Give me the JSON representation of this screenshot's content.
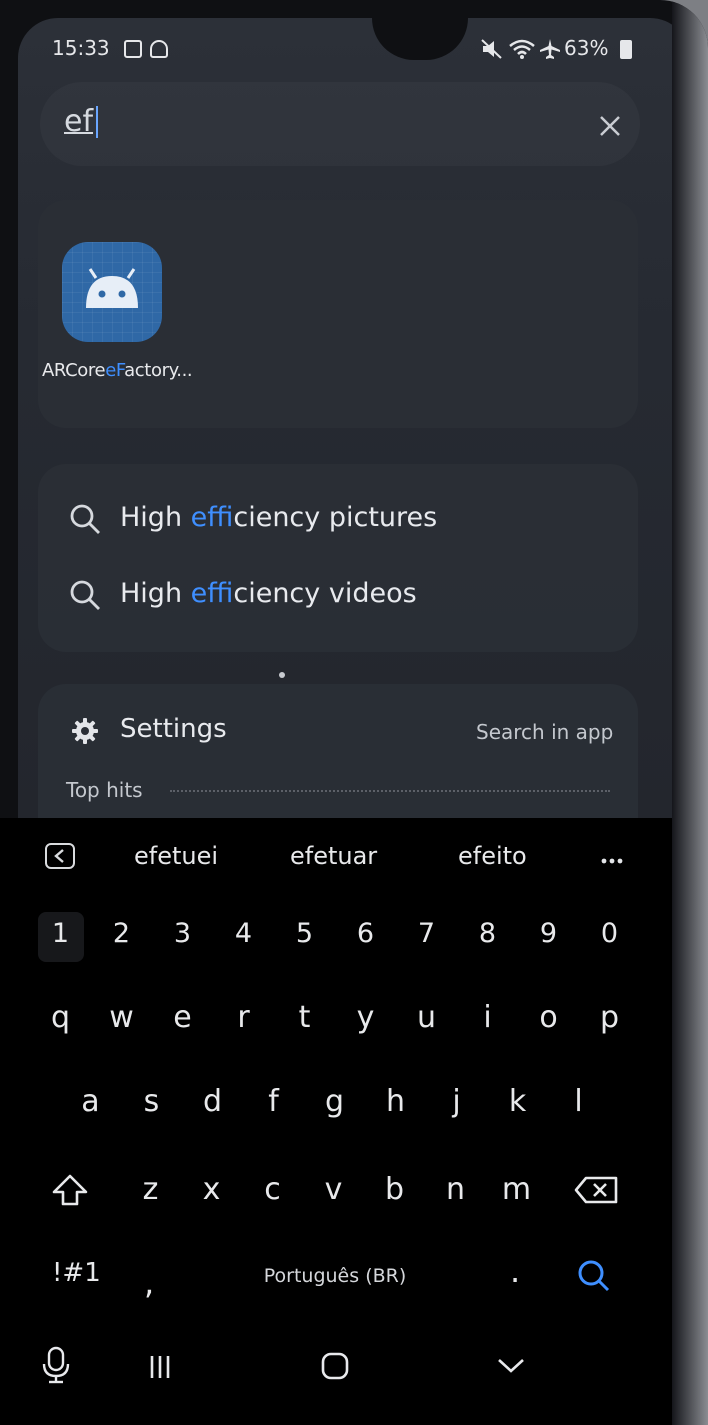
{
  "status_bar": {
    "time": "15:33",
    "battery": "63%"
  },
  "search": {
    "query": "ef",
    "placeholder": ""
  },
  "app_result": {
    "label_pre": "ARCore",
    "label_hl": "eF",
    "label_post": "actory..."
  },
  "suggestions": [
    {
      "pre": "High ",
      "hl": "ef",
      "post": "ficiency pictures"
    },
    {
      "pre": "High ",
      "hl": "ef",
      "post": "ficiency videos"
    }
  ],
  "settings_section": {
    "title": "Settings",
    "action": "Search in app",
    "subtitle": "Top hits"
  },
  "word_suggestions": [
    "efetuei",
    "efetuar",
    "efeito"
  ],
  "keyboard": {
    "numbers": [
      "1",
      "2",
      "3",
      "4",
      "5",
      "6",
      "7",
      "8",
      "9",
      "0"
    ],
    "row1": [
      "q",
      "w",
      "e",
      "r",
      "t",
      "y",
      "u",
      "i",
      "o",
      "p"
    ],
    "row2": [
      "a",
      "s",
      "d",
      "f",
      "g",
      "h",
      "j",
      "k",
      "l"
    ],
    "row3": [
      "z",
      "x",
      "c",
      "v",
      "b",
      "n",
      "m"
    ],
    "symbols_label": "!#1",
    "comma": ",",
    "space_label": "Português (BR)",
    "period": "."
  },
  "colors": {
    "highlight": "#3f8fff",
    "keyboard_bg": "#000000",
    "card_bg": "#2a2e36"
  }
}
